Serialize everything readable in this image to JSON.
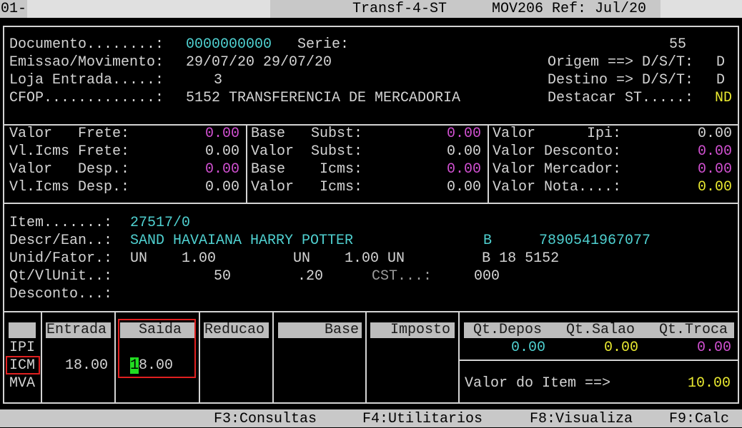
{
  "topbar": {
    "left": "01-",
    "title": "Transf-4-ST",
    "module": "MOV206 Ref: Jul/20"
  },
  "header": {
    "documento_label": "Documento........:",
    "documento_value": "0000000000",
    "serie_label": "Serie:",
    "serie_value": "55",
    "emissao_label": "Emissao/Movimento:",
    "emissao_value": "29/07/20 29/07/20",
    "origem_label": "Origem ==> D/S/T:",
    "origem_value": "D",
    "loja_label": "Loja Entrada.....:",
    "loja_value": "3",
    "destino_label": "Destino => D/S/T:",
    "destino_value": "D",
    "cfop_label": "CFOP.............:",
    "cfop_value": "5152 TRANSFERENCIA DE MERCADORIA",
    "destacar_label": "Destacar ST.....:",
    "destacar_value": "ND"
  },
  "values": {
    "col1": [
      {
        "label": "Valor   Frete:",
        "value": "0.00"
      },
      {
        "label": "Vl.Icms Frete:",
        "value": "0.00"
      },
      {
        "label": "Valor   Desp.:",
        "value": "0.00"
      },
      {
        "label": "Vl.Icms Desp.:",
        "value": "0.00"
      }
    ],
    "col2": [
      {
        "label": "Base   Subst:",
        "value": "0.00"
      },
      {
        "label": "Valor  Subst:",
        "value": "0.00"
      },
      {
        "label": "Base    Icms:",
        "value": "0.00"
      },
      {
        "label": "Valor   Icms:",
        "value": "0.00"
      }
    ],
    "col3": [
      {
        "label": "Valor      Ipi:",
        "value": "0.00"
      },
      {
        "label": "Valor Desconto:",
        "value": "0.00"
      },
      {
        "label": "Valor Mercador:",
        "value": "0.00"
      },
      {
        "label": "Valor Nota....:",
        "value": "0.00"
      }
    ]
  },
  "item": {
    "item_label": "Item.......:",
    "item_value": "27517/0",
    "descr_label": "Descr/Ean..:",
    "descr_value": "SAND HAVAIANA HARRY POTTER",
    "descr_code": "B",
    "ean": "7890541967077",
    "unid_label": "Unid/Fator.:",
    "unid_line": "UN    1.00         UN    1.00 UN         B 18 5152",
    "qt_label": "Qt/VlUnit..:",
    "qt_value": "50",
    "vlunit_value": ".20",
    "cst_label": "CST...:",
    "cst_value": "000",
    "desconto_label": "Desconto...:"
  },
  "tax_table": {
    "headers": {
      "entrada": "Entrada",
      "saida": "Saida",
      "reducao": "Reducao",
      "base": "Base",
      "imposto": "Imposto"
    },
    "rows": [
      "IPI",
      "ICM",
      "MVA"
    ],
    "icm_entrada": "18.00",
    "icm_saida_cursor": "1",
    "icm_saida_rest": "8.00"
  },
  "qty": {
    "headers": {
      "depos": "Qt.Depos",
      "salao": "Qt.Salao",
      "troca": "Qt.Troca"
    },
    "depos": "0.00",
    "salao": "0.00",
    "troca": "0.00",
    "valor_item_label": "Valor do Item ==>",
    "valor_item_value": "10.00"
  },
  "footer": {
    "f3": "F3:Consultas",
    "f4": "F4:Utilitarios",
    "f8": "F8:Visualiza",
    "f9": "F9:Calc"
  },
  "colors": {
    "cyan": "#4fd0d0",
    "magenta": "#d050d0",
    "yellow": "#e8e830",
    "highlight": "#e02020",
    "cursor": "#22dd22"
  }
}
